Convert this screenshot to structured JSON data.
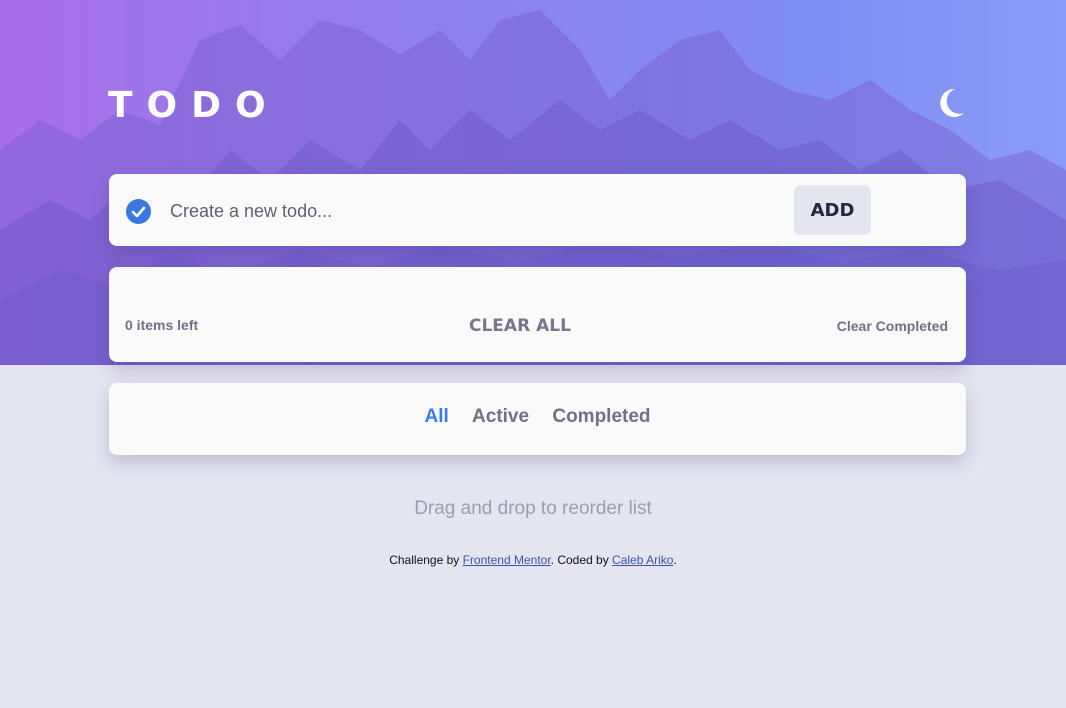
{
  "header": {
    "title": "TODO",
    "theme_icon": "moon-icon"
  },
  "create": {
    "check_icon": "check-circle-icon",
    "placeholder": "Create a new todo...",
    "value": "",
    "add_label": "ADD"
  },
  "list": {
    "items_left": "0 items left",
    "clear_all_label": "CLEAR ALL",
    "clear_completed_label": "Clear Completed",
    "items": []
  },
  "filters": {
    "all": "All",
    "active": "Active",
    "completed": "Completed",
    "selected": "All"
  },
  "drag_hint": "Drag and drop to reorder list",
  "attribution": {
    "prefix": "Challenge by ",
    "link1": "Frontend Mentor",
    "middle": ". Coded by ",
    "link2": "Caleb Ariko",
    "suffix": "."
  },
  "colors": {
    "accent_blue": "#3a7bfd",
    "page_background": "#e4e5f1",
    "card_background": "#fafafa",
    "hero_gradient_start": "#a86fe8",
    "hero_gradient_end": "#8a9cf7"
  }
}
